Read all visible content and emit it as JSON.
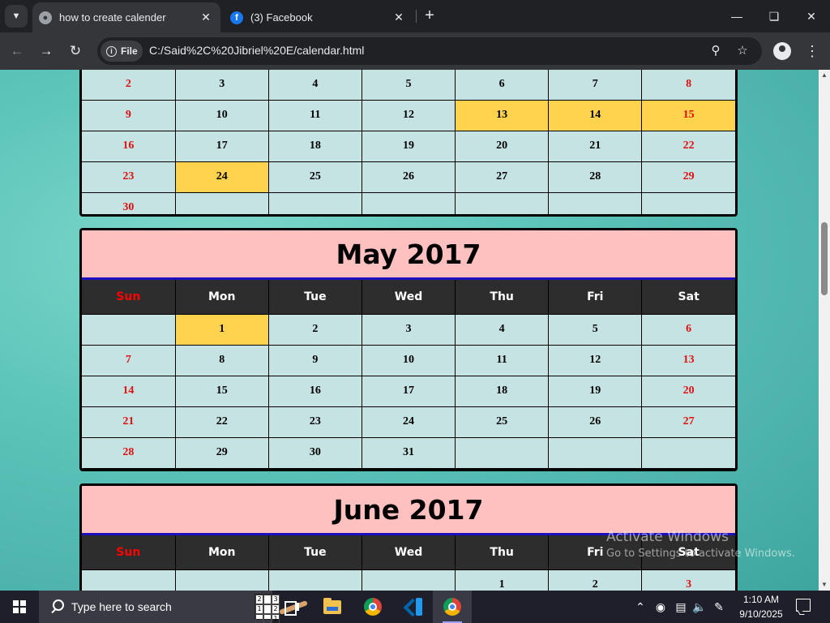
{
  "browser": {
    "tabs": [
      {
        "title": "how to create calender",
        "favicon": "globe-icon",
        "active": true
      },
      {
        "title": "(3) Facebook",
        "favicon": "facebook-icon",
        "active": false
      }
    ],
    "chip_label": "File",
    "url": "C:/Said%2C%20Jibriel%20E/calendar.html"
  },
  "colors": {
    "header_bg": "#ffc0c0",
    "weekday_bg": "#2d2d2d",
    "cell_bg": "#c5e3e3",
    "highlight": "#ffd34d",
    "weekend_text": "#e01010"
  },
  "calendars": [
    {
      "title": "",
      "show_header": false,
      "show_weekdays": false,
      "weeks": [
        [
          {
            "d": "2",
            "weekend": true
          },
          {
            "d": "3"
          },
          {
            "d": "4"
          },
          {
            "d": "5"
          },
          {
            "d": "6"
          },
          {
            "d": "7"
          },
          {
            "d": "8",
            "weekend": true
          }
        ],
        [
          {
            "d": "9",
            "weekend": true
          },
          {
            "d": "10"
          },
          {
            "d": "11"
          },
          {
            "d": "12"
          },
          {
            "d": "13",
            "hl": true
          },
          {
            "d": "14",
            "hl": true
          },
          {
            "d": "15",
            "weekend": true,
            "hl": true
          }
        ],
        [
          {
            "d": "16",
            "weekend": true
          },
          {
            "d": "17"
          },
          {
            "d": "18"
          },
          {
            "d": "19"
          },
          {
            "d": "20"
          },
          {
            "d": "21"
          },
          {
            "d": "22",
            "weekend": true
          }
        ],
        [
          {
            "d": "23",
            "weekend": true
          },
          {
            "d": "24",
            "hl": true
          },
          {
            "d": "25"
          },
          {
            "d": "26"
          },
          {
            "d": "27"
          },
          {
            "d": "28"
          },
          {
            "d": "29",
            "weekend": true
          }
        ],
        [
          {
            "d": "30",
            "weekend": true
          },
          {
            "d": ""
          },
          {
            "d": ""
          },
          {
            "d": ""
          },
          {
            "d": ""
          },
          {
            "d": ""
          },
          {
            "d": ""
          }
        ]
      ]
    },
    {
      "title": "May 2017",
      "show_header": true,
      "show_weekdays": true,
      "weeks": [
        [
          {
            "d": ""
          },
          {
            "d": "1",
            "hl": true
          },
          {
            "d": "2"
          },
          {
            "d": "3"
          },
          {
            "d": "4"
          },
          {
            "d": "5"
          },
          {
            "d": "6",
            "weekend": true
          }
        ],
        [
          {
            "d": "7",
            "weekend": true
          },
          {
            "d": "8"
          },
          {
            "d": "9"
          },
          {
            "d": "10"
          },
          {
            "d": "11"
          },
          {
            "d": "12"
          },
          {
            "d": "13",
            "weekend": true
          }
        ],
        [
          {
            "d": "14",
            "weekend": true
          },
          {
            "d": "15"
          },
          {
            "d": "16"
          },
          {
            "d": "17"
          },
          {
            "d": "18"
          },
          {
            "d": "19"
          },
          {
            "d": "20",
            "weekend": true
          }
        ],
        [
          {
            "d": "21",
            "weekend": true
          },
          {
            "d": "22"
          },
          {
            "d": "23"
          },
          {
            "d": "24"
          },
          {
            "d": "25"
          },
          {
            "d": "26"
          },
          {
            "d": "27",
            "weekend": true
          }
        ],
        [
          {
            "d": "28",
            "weekend": true
          },
          {
            "d": "29"
          },
          {
            "d": "30"
          },
          {
            "d": "31"
          },
          {
            "d": ""
          },
          {
            "d": ""
          },
          {
            "d": ""
          }
        ]
      ]
    },
    {
      "title": "June 2017",
      "show_header": true,
      "show_weekdays": true,
      "weeks": [
        [
          {
            "d": ""
          },
          {
            "d": ""
          },
          {
            "d": ""
          },
          {
            "d": ""
          },
          {
            "d": "1"
          },
          {
            "d": "2"
          },
          {
            "d": "3",
            "weekend": true
          }
        ]
      ]
    }
  ],
  "weekdays": [
    "Sun",
    "Mon",
    "Tue",
    "Wed",
    "Thu",
    "Fri",
    "Sat"
  ],
  "watermark": {
    "line1": "Activate Windows",
    "line2": "Go to Settings to activate Windows."
  },
  "taskbar": {
    "search_placeholder": "Type here to search",
    "sudoku_digits": [
      "2",
      "",
      "3",
      "1",
      "",
      "2",
      "",
      "",
      "1"
    ],
    "time": "1:10 AM",
    "date": "9/10/2025"
  }
}
